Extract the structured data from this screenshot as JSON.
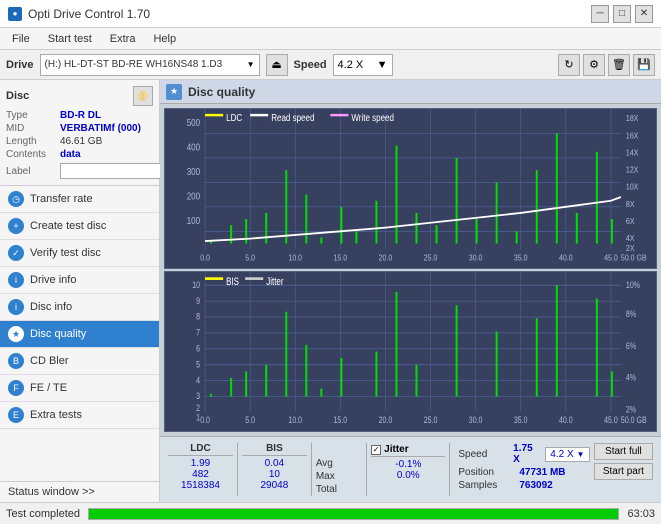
{
  "titlebar": {
    "title": "Opti Drive Control 1.70",
    "icon": "●",
    "min_btn": "─",
    "max_btn": "□",
    "close_btn": "✕"
  },
  "menubar": {
    "items": [
      "File",
      "Start test",
      "Extra",
      "Help"
    ]
  },
  "drivetoolbar": {
    "drive_label": "Drive",
    "drive_value": "(H:) HL-DT-ST BD-RE  WH16NS48 1.D3",
    "speed_label": "Speed",
    "speed_value": "4.2 X"
  },
  "disc": {
    "label": "Disc",
    "type_label": "Type",
    "type_value": "BD-R DL",
    "mid_label": "MID",
    "mid_value": "VERBATIMf (000)",
    "length_label": "Length",
    "length_value": "46.61 GB",
    "contents_label": "Contents",
    "contents_value": "data",
    "label_label": "Label",
    "label_value": ""
  },
  "nav": {
    "items": [
      {
        "id": "transfer-rate",
        "label": "Transfer rate",
        "active": false
      },
      {
        "id": "create-test-disc",
        "label": "Create test disc",
        "active": false
      },
      {
        "id": "verify-test-disc",
        "label": "Verify test disc",
        "active": false
      },
      {
        "id": "drive-info",
        "label": "Drive info",
        "active": false
      },
      {
        "id": "disc-info",
        "label": "Disc info",
        "active": false
      },
      {
        "id": "disc-quality",
        "label": "Disc quality",
        "active": true
      },
      {
        "id": "cd-bler",
        "label": "CD Bler",
        "active": false
      },
      {
        "id": "fe-te",
        "label": "FE / TE",
        "active": false
      },
      {
        "id": "extra-tests",
        "label": "Extra tests",
        "active": false
      }
    ]
  },
  "content": {
    "title": "Disc quality",
    "chart1": {
      "legend": [
        {
          "id": "ldc",
          "label": "LDC",
          "color": "#ffff00"
        },
        {
          "id": "read-speed",
          "label": "Read speed",
          "color": "#ffffff"
        },
        {
          "id": "write-speed",
          "label": "Write speed",
          "color": "#ff99ff"
        }
      ],
      "y_max": 500,
      "y_right_max": 18,
      "x_max": 50,
      "x_labels": [
        "0.0",
        "5.0",
        "10.0",
        "15.0",
        "20.0",
        "25.0",
        "30.0",
        "35.0",
        "40.0",
        "45.0",
        "50.0"
      ],
      "y_labels_left": [
        "500",
        "400",
        "300",
        "200",
        "100"
      ],
      "y_labels_right": [
        "18X",
        "16X",
        "14X",
        "12X",
        "10X",
        "8X",
        "6X",
        "4X",
        "2X"
      ]
    },
    "chart2": {
      "legend": [
        {
          "id": "bis",
          "label": "BIS",
          "color": "#ffff00"
        },
        {
          "id": "jitter",
          "label": "Jitter",
          "color": "#dddddd"
        }
      ],
      "y_max": 10,
      "y_right_max": 10,
      "x_max": 50,
      "x_labels": [
        "0.0",
        "5.0",
        "10.0",
        "15.0",
        "20.0",
        "25.0",
        "30.0",
        "35.0",
        "40.0",
        "45.0",
        "50.0"
      ],
      "y_labels_left": [
        "10",
        "9",
        "8",
        "7",
        "6",
        "5",
        "4",
        "3",
        "2",
        "1"
      ],
      "y_labels_right": [
        "10%",
        "8%",
        "6%",
        "4%",
        "2%"
      ]
    }
  },
  "stats": {
    "col_headers": [
      "LDC",
      "BIS",
      "",
      "Jitter",
      "Speed",
      ""
    ],
    "avg_label": "Avg",
    "max_label": "Max",
    "total_label": "Total",
    "ldc_avg": "1.99",
    "ldc_max": "482",
    "ldc_total": "1518384",
    "bis_avg": "0.04",
    "bis_max": "10",
    "bis_total": "29048",
    "jitter_avg": "-0.1%",
    "jitter_max": "0.0%",
    "jitter_total": "",
    "speed_label": "Speed",
    "speed_value": "1.75 X",
    "speed_select_value": "4.2 X",
    "position_label": "Position",
    "position_value": "47731 MB",
    "samples_label": "Samples",
    "samples_value": "763092",
    "start_full_label": "Start full",
    "start_part_label": "Start part",
    "jitter_checkbox": true
  },
  "statusbar": {
    "status_text": "Test completed",
    "progress": 100,
    "time": "63:03"
  },
  "status_window": {
    "label": "Status window >>",
    "arrow": ">>"
  }
}
